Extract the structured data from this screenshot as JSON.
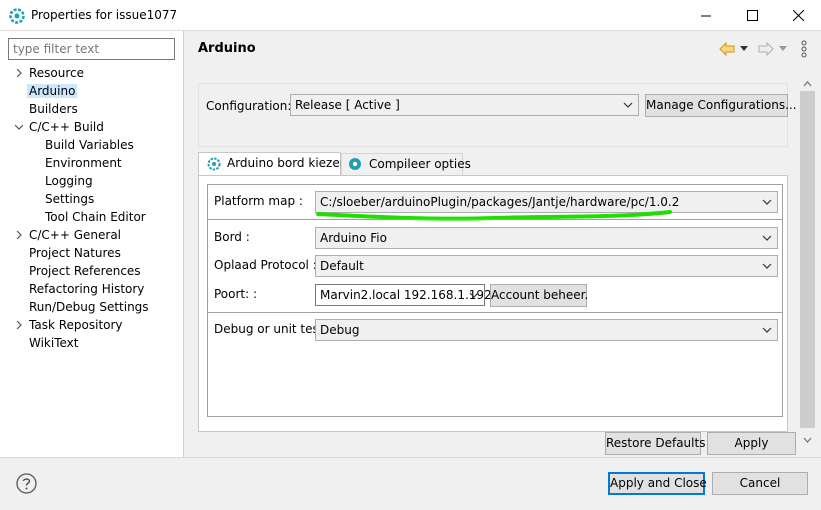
{
  "window": {
    "title": "Properties for issue1077"
  },
  "sidebar": {
    "filter_placeholder": "type filter text",
    "items": [
      {
        "label": "Resource",
        "arrow": "right"
      },
      {
        "label": "Arduino",
        "selected": true
      },
      {
        "label": "Builders"
      },
      {
        "label": "C/C++ Build",
        "arrow": "down"
      },
      {
        "label": "Build Variables"
      },
      {
        "label": "Environment"
      },
      {
        "label": "Logging"
      },
      {
        "label": "Settings"
      },
      {
        "label": "Tool Chain Editor"
      },
      {
        "label": "C/C++ General",
        "arrow": "right"
      },
      {
        "label": "Project Natures"
      },
      {
        "label": "Project References"
      },
      {
        "label": "Refactoring History"
      },
      {
        "label": "Run/Debug Settings"
      },
      {
        "label": "Task Repository",
        "arrow": "right"
      },
      {
        "label": "WikiText"
      }
    ]
  },
  "page": {
    "title": "Arduino",
    "configuration_label": "Configuration:",
    "configuration_value": "Release  [ Active ]",
    "manage_button": "Manage Configurations...",
    "tabs": [
      {
        "label": "Arduino bord kiezen",
        "active": true,
        "icon": "gear-icon"
      },
      {
        "label": "Compileer opties",
        "active": false,
        "icon": "gear-icon"
      }
    ],
    "fields": {
      "platform_label": "Platform map :",
      "platform_value": "C:/sloeber/arduinoPlugin/packages/Jantje/hardware/pc/1.0.2",
      "bord_label": "Bord :",
      "bord_value": "Arduino Fio",
      "protocol_label": "Oplaad Protocol :",
      "protocol_value": "Default",
      "port_label": "Poort: :",
      "port_value": "Marvin2.local 192.168.1.192",
      "account_button": "Account beheer.",
      "debug_label": "Debug or unit test",
      "debug_value": "Debug"
    },
    "restore_button": "Restore Defaults",
    "apply_button": "Apply"
  },
  "footer": {
    "apply_close_button": "Apply and Close",
    "cancel_button": "Cancel"
  },
  "colors": {
    "accent": "#0078d7",
    "selection": "#cce8ff",
    "highlight_stroke": "#22dd00",
    "history_arrow": "#d8a020"
  }
}
